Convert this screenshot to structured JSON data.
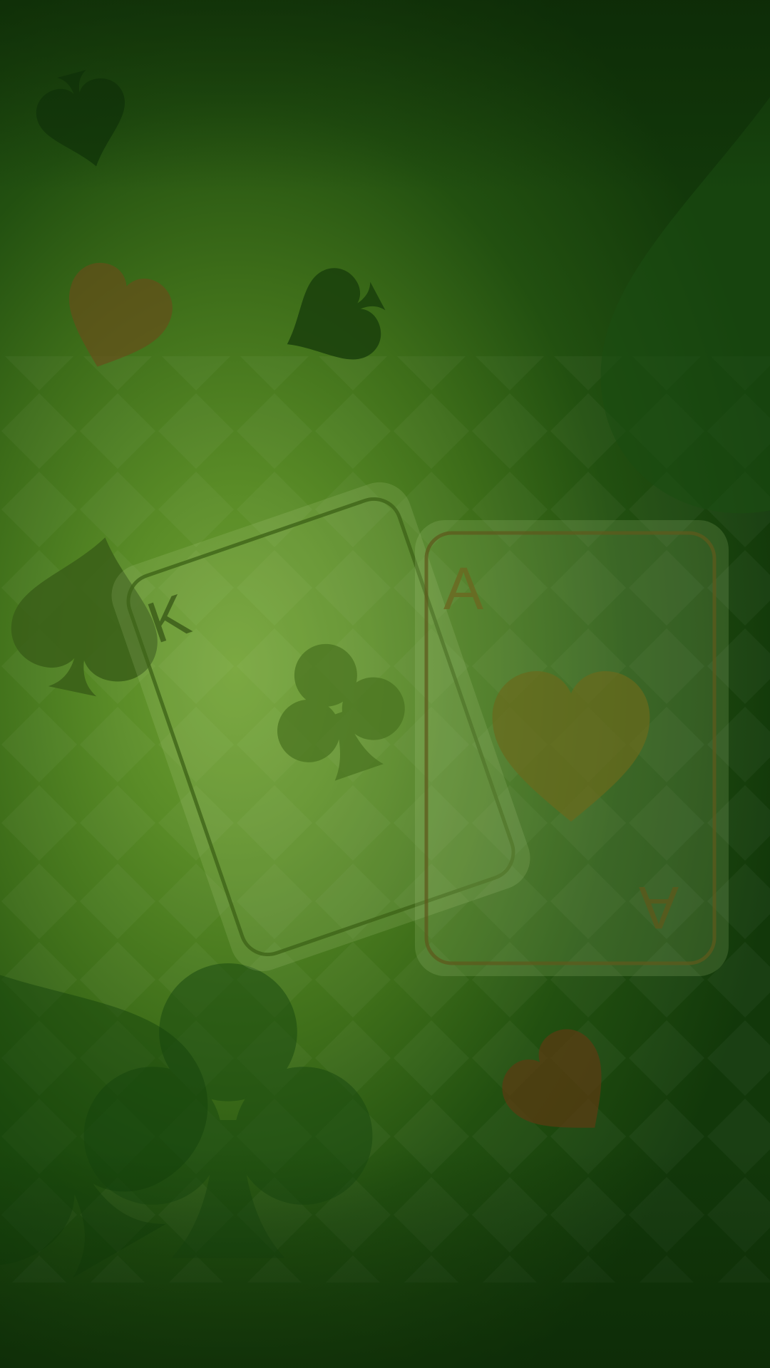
{
  "scene": {
    "cards": [
      {
        "rank": "K",
        "suit": "club-icon"
      },
      {
        "rank": "A",
        "suit": "heart-icon"
      }
    ],
    "colors": {
      "felt_center": "#6fa033",
      "felt_edge": "#12380a",
      "spade_dark": "#123a0a",
      "heart_brown": "#6b5a1c",
      "card_rank": "#4a6a22",
      "ace_rank": "#6b6a22"
    }
  }
}
